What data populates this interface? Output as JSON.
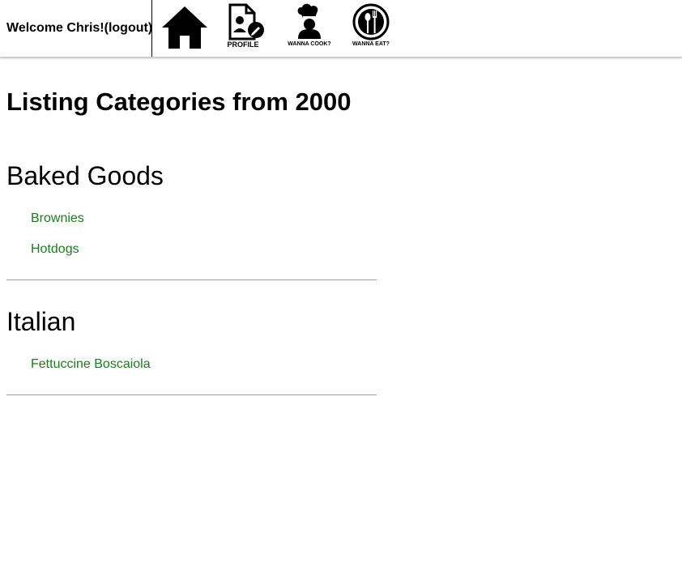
{
  "header": {
    "welcome_text": "Welcome Chris!",
    "logout_label": "(logout)",
    "nav": [
      {
        "icon": "home-icon",
        "label": ""
      },
      {
        "icon": "profile-icon",
        "label": "PROFILE"
      },
      {
        "icon": "chef-icon",
        "label": "WANNA COOK?"
      },
      {
        "icon": "plate-utensils-icon",
        "label": "WANNA EAT?"
      }
    ]
  },
  "main": {
    "title": "Listing Categories from 2000",
    "categories": [
      {
        "name": "Baked Goods",
        "recipes": [
          "Brownies",
          "Hotdogs"
        ]
      },
      {
        "name": "Italian",
        "recipes": [
          "Fettuccine Boscaiola"
        ]
      }
    ]
  },
  "colors": {
    "link": "#1e7a1e",
    "divider": "#9a9a9a"
  }
}
